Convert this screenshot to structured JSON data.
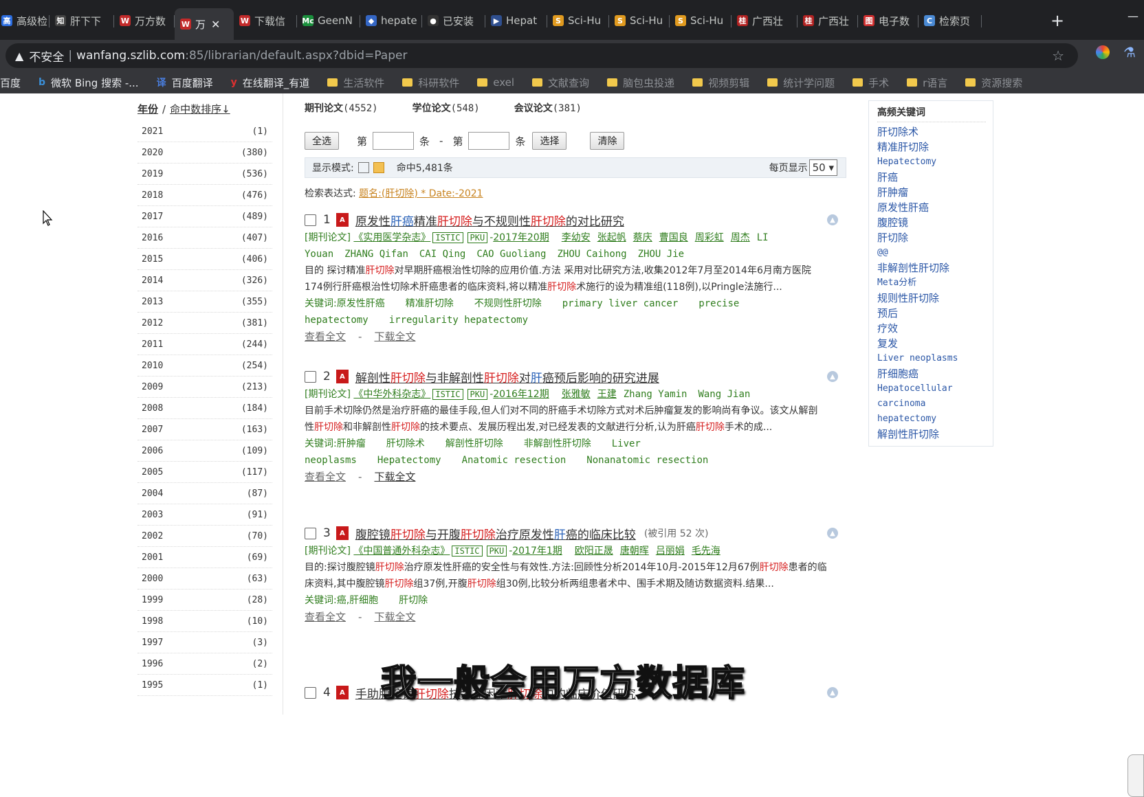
{
  "browser": {
    "tabs": [
      {
        "label": "高级检",
        "fav": "高",
        "fav_color": "#2b6de0",
        "active": false
      },
      {
        "label": "肝下下",
        "fav": "知",
        "fav_color": "#444444",
        "active": false
      },
      {
        "label": "万方数",
        "fav": "W",
        "fav_color": "#c22a2a",
        "active": false
      },
      {
        "label": "万",
        "fav": "W",
        "fav_color": "#c22a2a",
        "active": true
      },
      {
        "label": "下载信",
        "fav": "W",
        "fav_color": "#c22a2a",
        "active": false
      },
      {
        "label": "GeenN",
        "fav": "Mc",
        "fav_color": "#1a8f3c",
        "active": false
      },
      {
        "label": "hepate",
        "fav": "◆",
        "fav_color": "#3466c4",
        "active": false
      },
      {
        "label": "已安装",
        "fav": "●",
        "fav_color": "#333333",
        "active": false
      },
      {
        "label": "Hepat",
        "fav": "▶",
        "fav_color": "#2f4f8f",
        "active": false
      },
      {
        "label": "Sci-Hu",
        "fav": "S",
        "fav_color": "#e09a1f",
        "active": false
      },
      {
        "label": "Sci-Hu",
        "fav": "S",
        "fav_color": "#e09a1f",
        "active": false
      },
      {
        "label": "Sci-Hu",
        "fav": "S",
        "fav_color": "#e09a1f",
        "active": false
      },
      {
        "label": "广西壮",
        "fav": "桂",
        "fav_color": "#b22222",
        "active": false
      },
      {
        "label": "广西壮",
        "fav": "桂",
        "fav_color": "#b22222",
        "active": false
      },
      {
        "label": "电子数",
        "fav": "图",
        "fav_color": "#d03030",
        "active": false
      },
      {
        "label": "检索页",
        "fav": "C",
        "fav_color": "#4a8ad4",
        "active": false
      }
    ],
    "new_tab": "+",
    "insecure_label": "不安全",
    "url_host": "wanfang.szlib.com",
    "url_rest": ":85/librarian/default.aspx?dbid=Paper",
    "bookmarks": [
      {
        "label": "百度",
        "type": "link"
      },
      {
        "label": "微软 Bing 搜索 -...",
        "type": "bing"
      },
      {
        "label": "百度翻译",
        "type": "fanyi"
      },
      {
        "label": "在线翻译_有道",
        "type": "youdao"
      },
      {
        "label": "生活软件",
        "type": "folder"
      },
      {
        "label": "科研软件",
        "type": "folder"
      },
      {
        "label": "exel",
        "type": "folder"
      },
      {
        "label": "文献查询",
        "type": "folder"
      },
      {
        "label": "脑包虫投递",
        "type": "folder"
      },
      {
        "label": "视频剪辑",
        "type": "folder"
      },
      {
        "label": "统计学问题",
        "type": "folder"
      },
      {
        "label": "手术",
        "type": "folder"
      },
      {
        "label": "r语言",
        "type": "folder"
      },
      {
        "label": "资源搜索",
        "type": "folder"
      }
    ]
  },
  "sidebar": {
    "sort_year": "年份",
    "sort_slash": "/",
    "sort_hits": "命中数排序↓",
    "years": [
      {
        "year": "2021",
        "count": "(1)"
      },
      {
        "year": "2020",
        "count": "(380)"
      },
      {
        "year": "2019",
        "count": "(536)"
      },
      {
        "year": "2018",
        "count": "(476)"
      },
      {
        "year": "2017",
        "count": "(489)"
      },
      {
        "year": "2016",
        "count": "(407)"
      },
      {
        "year": "2015",
        "count": "(406)"
      },
      {
        "year": "2014",
        "count": "(326)"
      },
      {
        "year": "2013",
        "count": "(355)"
      },
      {
        "year": "2012",
        "count": "(381)"
      },
      {
        "year": "2011",
        "count": "(244)"
      },
      {
        "year": "2010",
        "count": "(254)"
      },
      {
        "year": "2009",
        "count": "(213)"
      },
      {
        "year": "2008",
        "count": "(184)"
      },
      {
        "year": "2007",
        "count": "(163)"
      },
      {
        "year": "2006",
        "count": "(109)"
      },
      {
        "year": "2005",
        "count": "(117)"
      },
      {
        "year": "2004",
        "count": "(87)"
      },
      {
        "year": "2003",
        "count": "(91)"
      },
      {
        "year": "2002",
        "count": "(70)"
      },
      {
        "year": "2001",
        "count": "(69)"
      },
      {
        "year": "2000",
        "count": "(63)"
      },
      {
        "year": "1999",
        "count": "(28)"
      },
      {
        "year": "1998",
        "count": "(10)"
      },
      {
        "year": "1997",
        "count": "(3)"
      },
      {
        "year": "1996",
        "count": "(2)"
      },
      {
        "year": "1995",
        "count": "(1)"
      }
    ]
  },
  "main": {
    "type_tabs": [
      {
        "label": "期刊论文",
        "count": "(4552)"
      },
      {
        "label": "学位论文",
        "count": "(548)"
      },
      {
        "label": "会议论文",
        "count": "(381)"
      }
    ],
    "select_all": "全选",
    "di1": "第",
    "tiao1": "条",
    "dash": "-",
    "di2": "第",
    "tiao2": "条",
    "choose": "选择",
    "clear": "清除",
    "display_mode": "显示模式:",
    "hits": "命中5,481条",
    "per_page_label": "每页显示",
    "per_page_value": "50",
    "expr_label": "检索表达式:",
    "expr_value": "题名:(肝切除) * Date:-2021",
    "view_full": "查看全文",
    "sep": "-",
    "download_full": "下载全文",
    "kw_label": "关键词:",
    "results": [
      {
        "num": "1",
        "title_parts": [
          {
            "t": "原发性",
            "c": ""
          },
          {
            "t": "肝癌",
            "c": "bl"
          },
          {
            "t": "精准",
            "c": ""
          },
          {
            "t": "肝切除",
            "c": "hl"
          },
          {
            "t": "与不规则性",
            "c": ""
          },
          {
            "t": "肝切除",
            "c": "hl"
          },
          {
            "t": "的对比研究",
            "c": ""
          }
        ],
        "cited": "",
        "type": "[期刊论文]",
        "journal": "《实用医学杂志》",
        "tags": [
          "ISTIC",
          "PKU"
        ],
        "date": "2017年20期",
        "authors": [
          "李幼安",
          "张起帆",
          "蔡庆",
          "曹国良",
          "周彩虹",
          "周杰"
        ],
        "authors_en": [
          "LI Youan",
          "ZHANG Qifan",
          "CAI Qing",
          "CAO Guoliang",
          "ZHOU Caihong",
          "ZHOU Jie"
        ],
        "abstract_parts": [
          {
            "t": "目的 探讨精准",
            "c": ""
          },
          {
            "t": "肝切除",
            "c": "hl"
          },
          {
            "t": "对早期肝癌根治性切除的应用价值.方法 采用对比研究方法,收集2012年7月至2014年6月南方医院174例行肝癌根治性切除术肝癌患者的临床资料,将以精准",
            "c": ""
          },
          {
            "t": "肝切除",
            "c": "hl"
          },
          {
            "t": "术施行的设为精准组(118例),以Pringle法施行...",
            "c": ""
          }
        ],
        "keywords": [
          "原发性肝癌",
          "精准肝切除",
          "不规则性肝切除",
          "primary liver cancer",
          "precise hepatectomy",
          "irregularity hepatectomy"
        ]
      },
      {
        "num": "2",
        "title_parts": [
          {
            "t": "解剖性",
            "c": ""
          },
          {
            "t": "肝切除",
            "c": "hl"
          },
          {
            "t": "与非解剖性",
            "c": ""
          },
          {
            "t": "肝切除",
            "c": "hl"
          },
          {
            "t": "对",
            "c": ""
          },
          {
            "t": "肝",
            "c": "bl"
          },
          {
            "t": "癌预后影响的研究进展",
            "c": ""
          }
        ],
        "cited": "",
        "type": "[期刊论文]",
        "journal": "《中华外科杂志》",
        "tags": [
          "ISTIC",
          "PKU"
        ],
        "date": "2016年12期",
        "authors": [
          "张雅敏",
          "王建"
        ],
        "authors_en": [
          "Zhang Yamin",
          "Wang Jian"
        ],
        "abstract_parts": [
          {
            "t": "目前手术切除仍然是治疗肝癌的最佳手段,但人们对不同的肝癌手术切除方式对术后肿瘤复发的影响尚有争议。该文从解剖性",
            "c": ""
          },
          {
            "t": "肝切除",
            "c": "hl"
          },
          {
            "t": "和非解剖性",
            "c": ""
          },
          {
            "t": "肝切除",
            "c": "hl"
          },
          {
            "t": "的技术要点、发展历程出发,对已经发表的文献进行分析,认为肝癌",
            "c": ""
          },
          {
            "t": "肝切除",
            "c": "hl"
          },
          {
            "t": "手术的成...",
            "c": ""
          }
        ],
        "keywords": [
          "肝肿瘤",
          "肝切除术",
          "解剖性肝切除",
          "非解剖性肝切除",
          "Liver neoplasms",
          "Hepatectomy",
          "Anatomic resection",
          "Nonanatomic resection"
        ]
      },
      {
        "num": "3",
        "title_parts": [
          {
            "t": "腹腔镜",
            "c": ""
          },
          {
            "t": "肝切除",
            "c": "hl"
          },
          {
            "t": "与开腹",
            "c": ""
          },
          {
            "t": "肝切除",
            "c": "hl"
          },
          {
            "t": "治疗原发性",
            "c": ""
          },
          {
            "t": "肝",
            "c": "bl"
          },
          {
            "t": "癌的临床比较",
            "c": ""
          }
        ],
        "cited": "(被引用 52 次)",
        "type": "[期刊论文]",
        "journal": "《中国普通外科杂志》",
        "tags": [
          "ISTIC",
          "PKU"
        ],
        "date": "2017年1期",
        "authors": [
          "欧阳正晟",
          "唐朝晖",
          "吕丽娟",
          "毛先海"
        ],
        "authors_en": [],
        "abstract_parts": [
          {
            "t": "目的:探讨腹腔镜",
            "c": ""
          },
          {
            "t": "肝切除",
            "c": "hl"
          },
          {
            "t": "治疗原发性肝癌的安全性与有效性.方法:回顾性分析2014年10月-2015年12月67例",
            "c": ""
          },
          {
            "t": "肝切除",
            "c": "hl"
          },
          {
            "t": "患者的临床资料,其中腹腔镜",
            "c": ""
          },
          {
            "t": "肝切除",
            "c": "hl"
          },
          {
            "t": "组37例,开腹",
            "c": ""
          },
          {
            "t": "肝切除",
            "c": "hl"
          },
          {
            "t": "组30例,比较分析两组患者术中、围手术期及随访数据资料.结果...",
            "c": ""
          }
        ],
        "keywords": [
          "癌,肝细胞",
          "肝切除"
        ]
      },
      {
        "num": "4",
        "title_parts": [
          {
            "t": "手助腹腔镜",
            "c": ""
          },
          {
            "t": "肝切除",
            "c": "hl"
          },
          {
            "t": "技术在困难",
            "c": ""
          },
          {
            "t": "肝切除",
            "c": "hl"
          },
          {
            "t": "中的临床价值研究",
            "c": ""
          }
        ],
        "cited": "",
        "type": "",
        "journal": "",
        "tags": [],
        "date": "",
        "authors": [],
        "authors_en": [],
        "abstract_parts": [],
        "keywords": []
      }
    ]
  },
  "keywords_panel": {
    "title": "高频关键词",
    "items": [
      "肝切除术",
      "精准肝切除",
      "Hepatectomy",
      "肝癌",
      "肝肿瘤",
      "原发性肝癌",
      "腹腔镜",
      "肝切除",
      "@@",
      "非解剖性肝切除",
      "Meta分析",
      "规则性肝切除",
      "预后",
      "疗效",
      "复发",
      "Liver neoplasms",
      "肝细胞癌",
      "Hepatocellular carcinoma",
      "hepatectomy",
      "解剖性肝切除"
    ]
  },
  "subtitle": "我一般会用万方数据库"
}
